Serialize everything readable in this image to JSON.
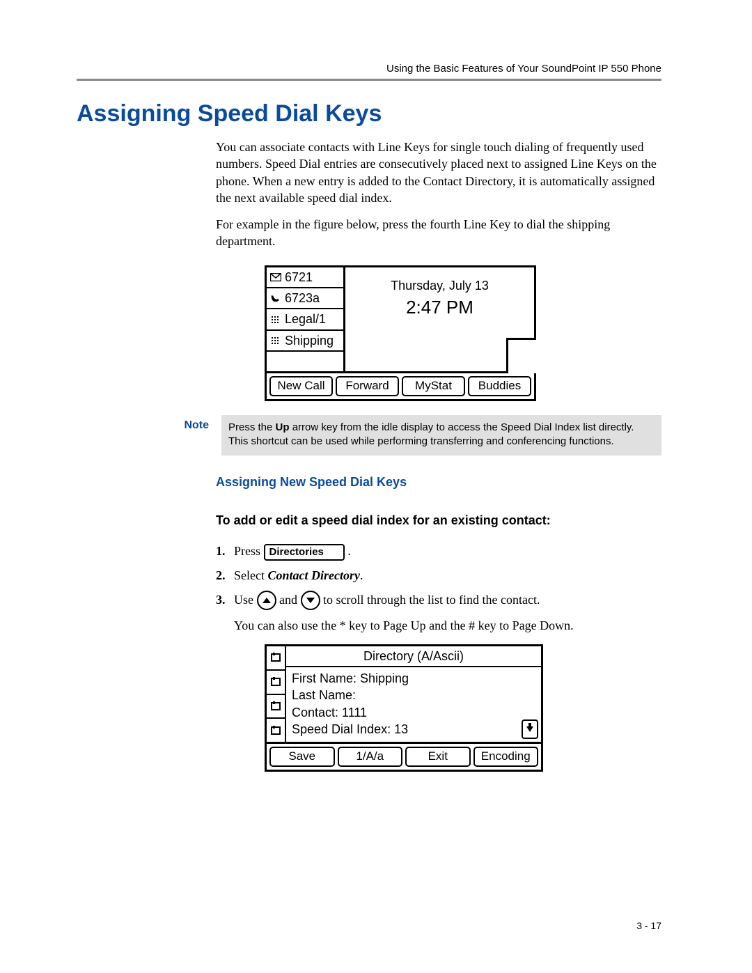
{
  "header": {
    "running": "Using the Basic Features of Your SoundPoint IP 550 Phone"
  },
  "title": "Assigning Speed Dial Keys",
  "para1": "You can associate contacts with Line Keys for single touch dialing of frequently used numbers. Speed Dial entries are consecutively placed next to assigned Line Keys on the phone. When a new entry is added to the Contact Directory, it is automatically assigned the next available speed dial index.",
  "para2": "For example in the figure below, press the fourth Line Key to dial the shipping department.",
  "screen1": {
    "lines": [
      "6721",
      "6723a",
      "Legal/1",
      "Shipping"
    ],
    "date": "Thursday, July 13",
    "time": "2:47 PM",
    "softkeys": [
      "New Call",
      "Forward",
      "MyStat",
      "Buddies"
    ]
  },
  "note": {
    "label": "Note",
    "pre": "Press the ",
    "bold": "Up",
    "post": " arrow key from the idle display to access the Speed Dial Index list directly. This shortcut can be used while performing transferring and conferencing functions."
  },
  "subTitle": "Assigning New Speed Dial Keys",
  "taskTitle": "To add or edit a speed dial index for an existing contact:",
  "steps": {
    "s1a": "Press ",
    "s1btn": "Directories",
    "s1b": " .",
    "s2a": "Select ",
    "s2em": "Contact Directory",
    "s2b": ".",
    "s3a": "Use ",
    "s3mid": " and ",
    "s3b": " to scroll through the list to find the contact."
  },
  "afterSteps": "You can also use the * key to Page Up and the # key to Page Down.",
  "screen2": {
    "title": "Directory (A/Ascii)",
    "fields": {
      "first": "First Name: Shipping",
      "last": "Last Name:",
      "contact": "Contact: 1111",
      "sdi": "Speed Dial Index: 13"
    },
    "softkeys": [
      "Save",
      "1/A/a",
      "Exit",
      "Encoding"
    ]
  },
  "pageNumber": "3 - 17"
}
